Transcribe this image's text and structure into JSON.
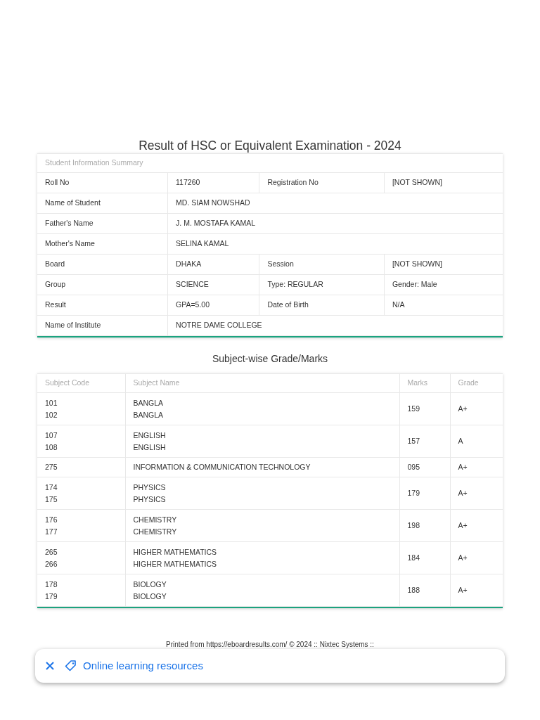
{
  "title": "Result of HSC or Equivalent Examination - 2024",
  "student_info": {
    "heading": "Student Information Summary",
    "rows": [
      [
        "Roll No",
        "117260",
        "Registration No",
        "[NOT SHOWN]"
      ],
      [
        "Name of Student",
        {
          "text": "MD. SIAM NOWSHAD",
          "colspan": 3
        }
      ],
      [
        "Father's Name",
        {
          "text": "J. M. MOSTAFA KAMAL",
          "colspan": 3
        }
      ],
      [
        "Mother's Name",
        {
          "text": "SELINA KAMAL",
          "colspan": 3
        }
      ],
      [
        "Board",
        "DHAKA",
        "Session",
        "[NOT SHOWN]"
      ],
      [
        "Group",
        "SCIENCE",
        "Type: REGULAR",
        "Gender: Male"
      ],
      [
        "Result",
        "GPA=5.00",
        "Date of Birth",
        "N/A"
      ],
      [
        "Name of Institute",
        {
          "text": "NOTRE DAME COLLEGE",
          "colspan": 3
        }
      ]
    ]
  },
  "subjects_heading": "Subject-wise Grade/Marks",
  "subjects": {
    "columns": [
      "Subject Code",
      "Subject Name",
      "Marks",
      "Grade"
    ],
    "rows": [
      {
        "codes": [
          "101",
          "102"
        ],
        "names": [
          "BANGLA",
          "BANGLA"
        ],
        "marks": "159",
        "grade": "A+"
      },
      {
        "codes": [
          "107",
          "108"
        ],
        "names": [
          "ENGLISH",
          "ENGLISH"
        ],
        "marks": "157",
        "grade": "A"
      },
      {
        "codes": [
          "275"
        ],
        "names": [
          "INFORMATION & COMMUNICATION TECHNOLOGY"
        ],
        "marks": "095",
        "grade": "A+"
      },
      {
        "codes": [
          "174",
          "175"
        ],
        "names": [
          "PHYSICS",
          "PHYSICS"
        ],
        "marks": "179",
        "grade": "A+"
      },
      {
        "codes": [
          "176",
          "177"
        ],
        "names": [
          "CHEMISTRY",
          "CHEMISTRY"
        ],
        "marks": "198",
        "grade": "A+"
      },
      {
        "codes": [
          "265",
          "266"
        ],
        "names": [
          "HIGHER MATHEMATICS",
          "HIGHER MATHEMATICS"
        ],
        "marks": "184",
        "grade": "A+"
      },
      {
        "codes": [
          "178",
          "179"
        ],
        "names": [
          "BIOLOGY",
          "BIOLOGY"
        ],
        "marks": "188",
        "grade": "A+"
      }
    ]
  },
  "footer": "Printed from https://eboardresults.com/ © 2024 :: Nixtec Systems ::",
  "chip": {
    "label": "Online learning resources"
  }
}
